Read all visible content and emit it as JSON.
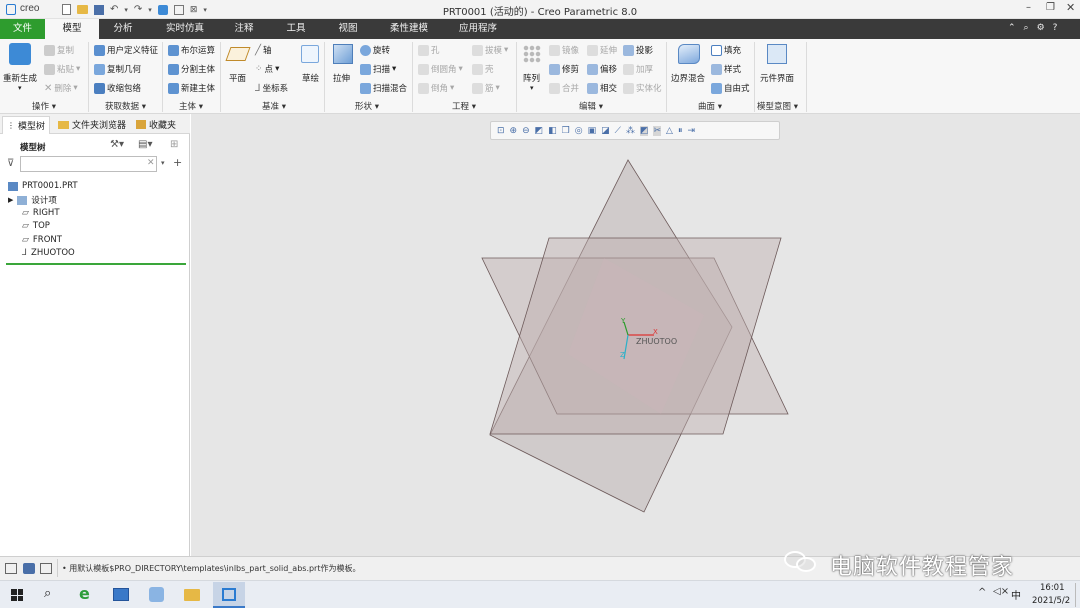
{
  "app": {
    "logo": "creo",
    "window_title": "PRT0001 (活动的) - Creo Parametric 8.0"
  },
  "tabs": [
    "文件",
    "模型",
    "分析",
    "实时仿真",
    "注释",
    "工具",
    "视图",
    "柔性建模",
    "应用程序"
  ],
  "ribbon": {
    "regen_label": "重新生成",
    "op_copy": "复制",
    "op_paste": "粘贴",
    "op_delete": "删除",
    "udf": "用户定义特征",
    "copy_geom": "复制几何",
    "shrinkwrap": "收缩包络",
    "boolean": "布尔运算",
    "split_body": "分割主体",
    "new_body": "新建主体",
    "plane": "平面",
    "axis": "轴",
    "point": "点",
    "csys": "坐标系",
    "sketch": "草绘",
    "extrude": "拉伸",
    "revolve": "旋转",
    "sweep": "扫描",
    "swept_blend": "扫描混合",
    "hole": "孔",
    "round": "倒圆角",
    "chamfer": "倒角",
    "draft": "拔模",
    "shell": "壳",
    "rib": "筋",
    "pattern": "阵列",
    "mirror": "镜像",
    "extend": "延伸",
    "project": "投影",
    "trim": "修剪",
    "offset": "偏移",
    "thicken": "加厚",
    "merge": "合并",
    "intersect": "相交",
    "solidify": "实体化",
    "boundary_blend": "边界混合",
    "fill": "填充",
    "style": "样式",
    "freestyle": "自由式",
    "component_iface": "元件界面",
    "groups": [
      "操作",
      "获取数据",
      "主体",
      "基准",
      "形状",
      "工程",
      "编辑",
      "曲面",
      "模型意图"
    ]
  },
  "panel": {
    "tabs": [
      "模型树",
      "文件夹浏览器",
      "收藏夹"
    ],
    "header": "模型树",
    "filter_placeholder": "",
    "tree": [
      "PRT0001.PRT",
      "设计项",
      "RIGHT",
      "TOP",
      "FRONT",
      "ZHUOTOO"
    ]
  },
  "viewport": {
    "csys_label": "ZHUOTOO",
    "axis_x": "X",
    "axis_y": "Y",
    "axis_z": "Z"
  },
  "status": {
    "message": "• 用默认模板$PRO_DIRECTORY\\templates\\inlbs_part_solid_abs.prt作为模板。",
    "watermark": "电脑软件教程管家"
  },
  "taskbar": {
    "time": "16:01",
    "date": "2021/5/2",
    "ime": "中"
  }
}
